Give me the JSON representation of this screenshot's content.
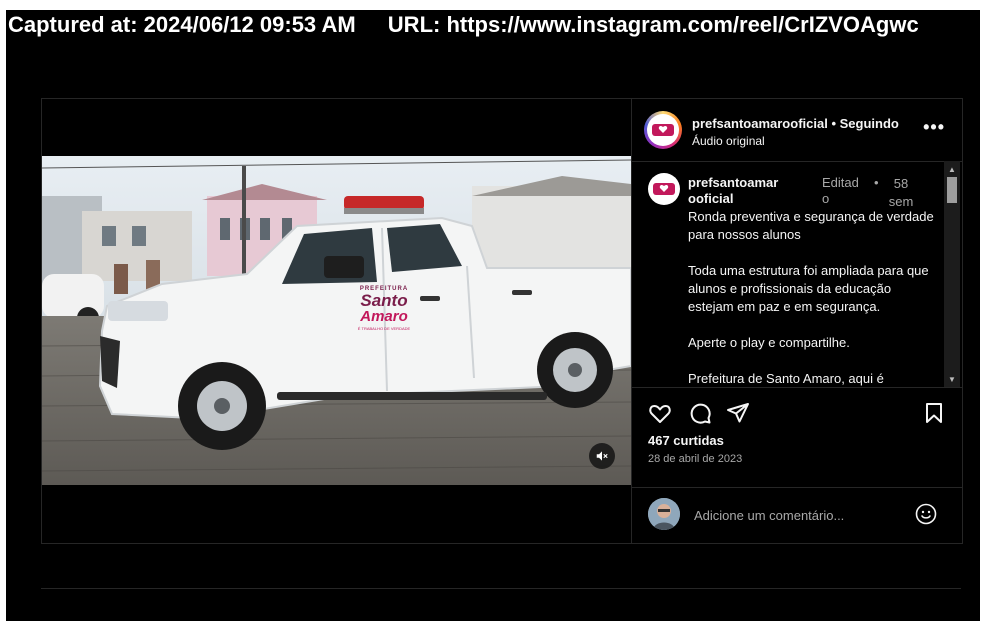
{
  "capture": {
    "timestamp": "Captured at: 2024/06/12 09:53 AM",
    "url": "URL: https://www.instagram.com/reel/CrIZVOAgwc"
  },
  "post": {
    "header": {
      "username": "prefsantoamarooficial",
      "separator": " • ",
      "follow_status": "Seguindo",
      "audio": "Áudio original",
      "more_icon": "more-horizontal-icon"
    },
    "caption": {
      "username": "prefsantoamarooficial",
      "edited": "Editado",
      "dot": "•",
      "time_ago": "58 sem",
      "paragraphs": [
        "Ronda preventiva e segurança de verdade para nossos alunos",
        "Toda uma estrutura foi ampliada para que alunos e profissionais da educação estejam em paz e em segurança.",
        "Aperte o play e compartilhe.",
        "Prefeitura de Santo Amaro, aqui é"
      ]
    },
    "video": {
      "logo_line1": "PREFEITURA",
      "logo_line2": "Santo",
      "logo_line3": "Amaro",
      "logo_tagline": "É TRABALHO DE VERDADE",
      "mute_icon": "muted-speaker-icon"
    },
    "actions": {
      "icons": [
        "heart-icon",
        "comment-icon",
        "share-icon",
        "bookmark-icon"
      ],
      "likes": "467 curtidas",
      "date": "28 de abril de 2023"
    },
    "comment": {
      "placeholder": "Adicione um comentário...",
      "emoji_icon": "emoji-icon"
    }
  },
  "colors": {
    "background": "#000000",
    "text": "#f5f5f5",
    "muted": "#a8a8a8",
    "border": "#262626",
    "brand_red": "#c2185b"
  }
}
